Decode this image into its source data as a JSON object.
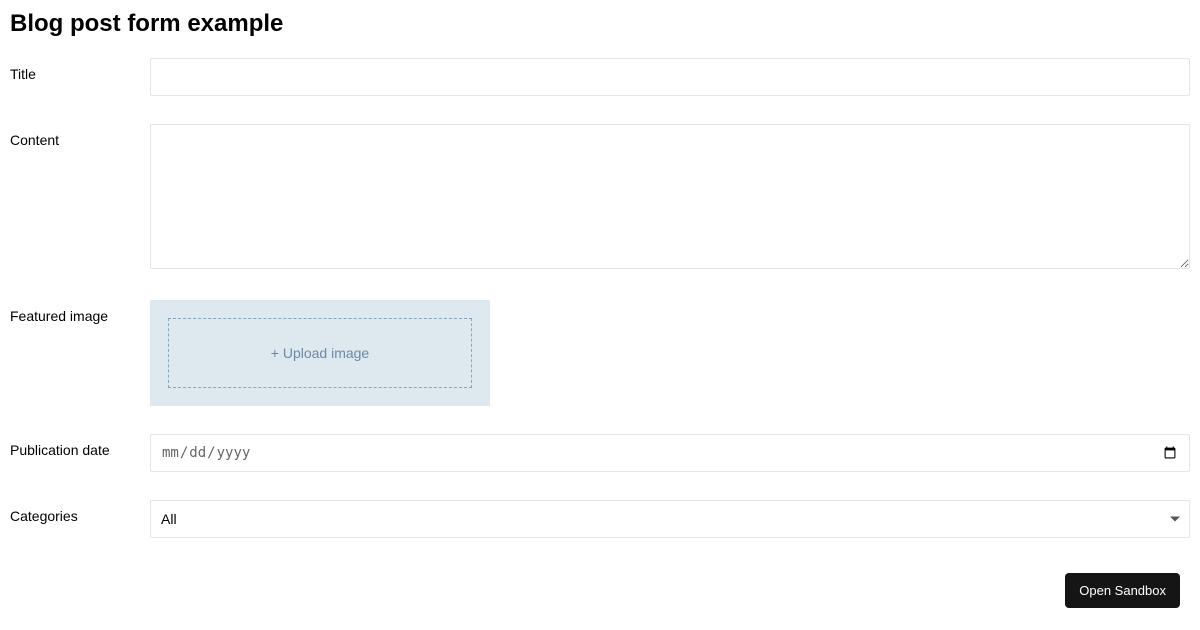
{
  "page": {
    "title": "Blog post form example"
  },
  "form": {
    "title": {
      "label": "Title",
      "value": ""
    },
    "content": {
      "label": "Content",
      "value": ""
    },
    "featured_image": {
      "label": "Featured image",
      "upload_text": "+ Upload image"
    },
    "publication_date": {
      "label": "Publication date",
      "placeholder": "mm/dd/yyyy",
      "value": ""
    },
    "categories": {
      "label": "Categories",
      "selected": "All"
    }
  },
  "sandbox_button": "Open Sandbox"
}
